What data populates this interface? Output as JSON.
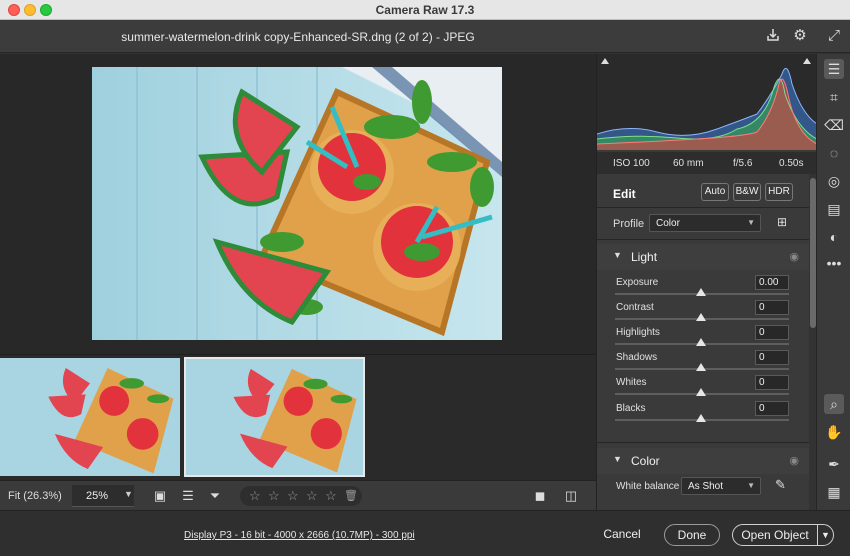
{
  "window": {
    "title": "Camera Raw 17.3"
  },
  "header": {
    "filename": "summer-watermelon-drink copy-Enhanced-SR.dng (2 of 2)  -  JPEG"
  },
  "histogram": {
    "exif": {
      "iso": "ISO 100",
      "focal": "60 mm",
      "aperture": "f/5.6",
      "shutter": "0.50s"
    }
  },
  "edit": {
    "title": "Edit",
    "buttons": {
      "auto": "Auto",
      "bw": "B&W",
      "hdr": "HDR"
    },
    "profile_label": "Profile",
    "profile_value": "Color",
    "light": {
      "title": "Light",
      "sliders": [
        {
          "label": "Exposure",
          "value": "0.00"
        },
        {
          "label": "Contrast",
          "value": "0"
        },
        {
          "label": "Highlights",
          "value": "0"
        },
        {
          "label": "Shadows",
          "value": "0"
        },
        {
          "label": "Whites",
          "value": "0"
        },
        {
          "label": "Blacks",
          "value": "0"
        }
      ]
    },
    "color": {
      "title": "Color",
      "wb_label": "White balance",
      "wb_value": "As Shot"
    }
  },
  "bottom_toolbar": {
    "fit_label": "Fit (26.3%)",
    "zoom_value": "25%"
  },
  "statusbar": {
    "info": "Display P3 - 16 bit - 4000 x 2666 (10.7MP) - 300 ppi",
    "cancel": "Cancel",
    "done": "Done",
    "open": "Open Object"
  },
  "colors": {
    "accent": "#ffffff",
    "panel": "#3a3a3a",
    "canvas": "#282828"
  }
}
